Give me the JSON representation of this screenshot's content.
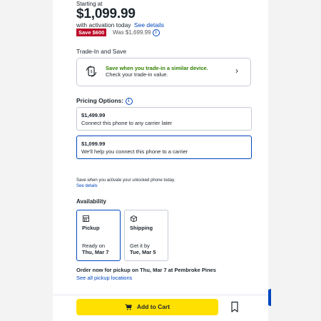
{
  "price_block": {
    "starting_label": "Starting at",
    "price": "$1,099.99",
    "activation_text": "with activation today",
    "see_details": "See details",
    "save_badge": "Save $600",
    "was_price": "Was $1,699.99"
  },
  "trade_in": {
    "heading": "Trade-In and Save",
    "promo_title": "Save when you trade-in a similar device.",
    "promo_subtitle": "Check your trade-in value.",
    "icon": "trade-in-phone-icon"
  },
  "pricing_options": {
    "heading": "Pricing Options:",
    "options": [
      {
        "price": "$1,499.99",
        "description": "Connect this phone to any carrier later",
        "selected": false
      },
      {
        "price": "$1,099.99",
        "description": "We'll help you connect this phone to a carrier",
        "selected": true
      }
    ]
  },
  "activation_note": {
    "text": "Save when you activate your unlocked phone today.",
    "link": "See details"
  },
  "availability": {
    "heading": "Availability",
    "cards": [
      {
        "title": "Pickup",
        "line1": "Ready on",
        "line2": "Thu, Mar 7",
        "icon": "store-icon",
        "selected": true
      },
      {
        "title": "Shipping",
        "line1": "Get it by",
        "line2": "Tue, Mar 5",
        "icon": "box-icon",
        "selected": false
      }
    ],
    "order_note": "Order now for pickup on Thu, Mar 7 at Pembroke Pines",
    "locations_link": "See all pickup locations"
  },
  "actions": {
    "add_to_cart": "Add to Cart",
    "save_icon": "bookmark-icon"
  },
  "colors": {
    "accent_blue": "#0046be",
    "sale_red": "#bb0628",
    "promo_green": "#318000",
    "cart_yellow": "#ffe000"
  }
}
